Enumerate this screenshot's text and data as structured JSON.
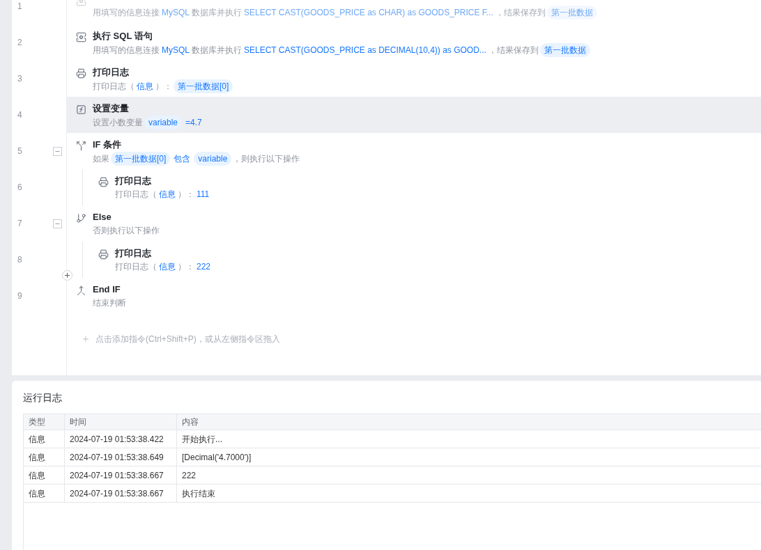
{
  "steps": [
    {
      "number": "1",
      "kind": "sql",
      "disabled": true,
      "selected": false,
      "description": [
        {
          "kind": "text",
          "text": "用填写的信息连接"
        },
        {
          "kind": "value",
          "text": "MySQL"
        },
        {
          "kind": "text",
          "text": "数据库并执行"
        },
        {
          "kind": "value",
          "text": "SELECT CAST(GOODS_PRICE as CHAR) as  GOODS_PRICE F..."
        },
        {
          "kind": "text",
          "text": "，结果保存到"
        },
        {
          "kind": "tag",
          "text": "第一批数据"
        }
      ]
    },
    {
      "number": "2",
      "kind": "sql",
      "title": "执行 SQL 语句",
      "disabled": false,
      "selected": false,
      "description": [
        {
          "kind": "text",
          "text": "用填写的信息连接"
        },
        {
          "kind": "value",
          "text": "MySQL"
        },
        {
          "kind": "text",
          "text": "数据库并执行"
        },
        {
          "kind": "value",
          "text": "SELECT CAST(GOODS_PRICE as DECIMAL(10,4)) as  GOOD..."
        },
        {
          "kind": "text",
          "text": "，结果保存到"
        },
        {
          "kind": "tag",
          "text": "第一批数据"
        }
      ]
    },
    {
      "number": "3",
      "kind": "log",
      "title": "打印日志",
      "disabled": false,
      "selected": false,
      "description": [
        {
          "kind": "text",
          "text": "打印日志（"
        },
        {
          "kind": "value",
          "text": "信息"
        },
        {
          "kind": "text",
          "text": "）："
        },
        {
          "kind": "tag",
          "text": "第一批数据[0]"
        }
      ]
    },
    {
      "number": "4",
      "kind": "set_variable",
      "title": "设置变量",
      "disabled": false,
      "selected": true,
      "description": [
        {
          "kind": "text",
          "text": "设置小数变量"
        },
        {
          "kind": "tag",
          "text": "variable"
        },
        {
          "kind": "value",
          "text": "=4.7"
        }
      ]
    },
    {
      "number": "5",
      "kind": "if",
      "title": "IF 条件",
      "disabled": false,
      "selected": false,
      "expanded": true,
      "description": [
        {
          "kind": "text",
          "text": "如果"
        },
        {
          "kind": "tag",
          "text": "第一批数据[0]"
        },
        {
          "kind": "value",
          "text": "包含"
        },
        {
          "kind": "tag",
          "text": "variable"
        },
        {
          "kind": "text",
          "text": "，则执行以下操作"
        }
      ],
      "children": [
        {
          "number": "6",
          "kind": "log",
          "title": "打印日志",
          "disabled": false,
          "selected": false,
          "description": [
            {
              "kind": "text",
              "text": "打印日志（"
            },
            {
              "kind": "value",
              "text": "信息"
            },
            {
              "kind": "text",
              "text": "）："
            },
            {
              "kind": "value",
              "text": "111"
            }
          ]
        }
      ]
    },
    {
      "number": "7",
      "kind": "else",
      "title": "Else",
      "disabled": false,
      "selected": false,
      "expanded": true,
      "description": [
        {
          "kind": "text",
          "text": "否则执行以下操作"
        }
      ],
      "children": [
        {
          "number": "8",
          "kind": "log",
          "title": "打印日志",
          "disabled": false,
          "selected": false,
          "description": [
            {
              "kind": "text",
              "text": "打印日志（"
            },
            {
              "kind": "value",
              "text": "信息"
            },
            {
              "kind": "text",
              "text": "）："
            },
            {
              "kind": "value",
              "text": "222"
            }
          ]
        }
      ]
    },
    {
      "number": "9",
      "kind": "end_if",
      "title": "End IF",
      "disabled": false,
      "selected": false,
      "description": [
        {
          "kind": "text",
          "text": "结束判断"
        }
      ]
    }
  ],
  "add_hint": "点击添加指令(Ctrl+Shift+P)，或从左侧指令区拖入",
  "log": {
    "title": "运行日志",
    "columns": [
      "类型",
      "时间",
      "内容"
    ],
    "rows": [
      [
        "信息",
        "2024-07-19 01:53:38.422",
        "开始执行..."
      ],
      [
        "信息",
        "2024-07-19 01:53:38.649",
        "[Decimal('4.7000')]"
      ],
      [
        "信息",
        "2024-07-19 01:53:38.667",
        "222"
      ],
      [
        "信息",
        "2024-07-19 01:53:38.667",
        "执行结束"
      ]
    ]
  }
}
